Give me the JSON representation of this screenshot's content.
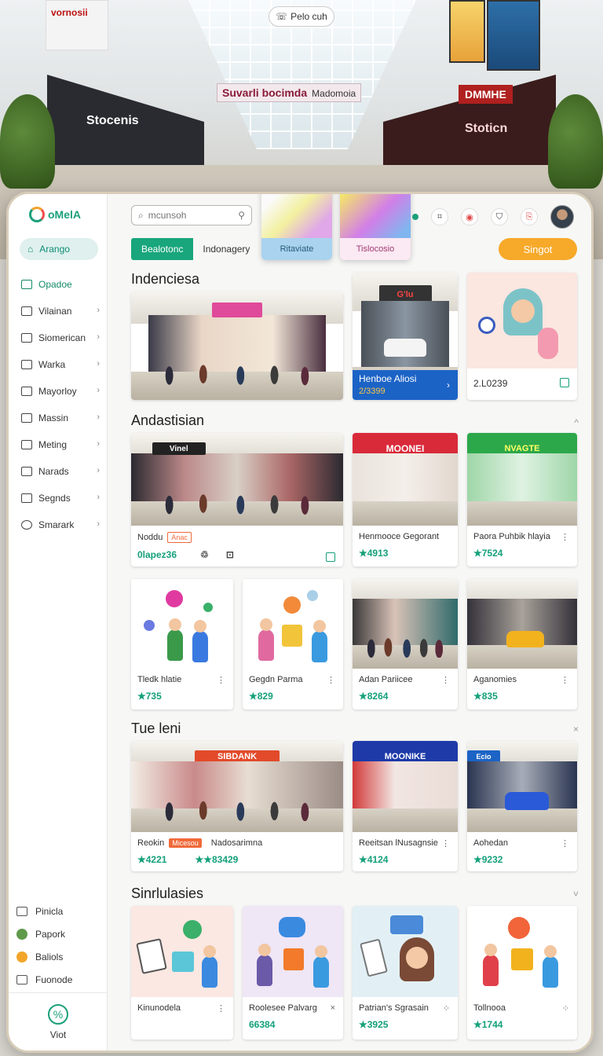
{
  "backdrop": {
    "banner_top": "vornosii",
    "banner_mid": "Suvarli bocimda",
    "banner_mid_sub": "Madomoia",
    "search_pill": "Pelo cuh",
    "store_sign_left": "Stocenis",
    "store_sign_right": "Stoticn",
    "store_sign_red": "DMMHE"
  },
  "app": {
    "logo": "oMelA",
    "search": {
      "placeholder": "mcunsoh"
    },
    "popups": [
      {
        "label": "Ritaviate"
      },
      {
        "label": "Tislocosio"
      }
    ],
    "tabs": [
      {
        "label": "Bealotonc"
      },
      {
        "label": "Indonagery"
      }
    ],
    "signup": "Singot",
    "colors": {
      "accent": "#19a67c",
      "cta": "#f7a92a",
      "value": "#14a07a",
      "caption": "#1c63c6",
      "tag": "#f06a3a"
    }
  },
  "sidebar": {
    "active": {
      "label": "Arango",
      "icon": "home-icon"
    },
    "items": [
      {
        "label": "Opadoe",
        "icon": "folder-icon",
        "green": true
      },
      {
        "label": "Vilainan",
        "icon": "list-icon"
      },
      {
        "label": "Siomerican",
        "icon": "tag-icon"
      },
      {
        "label": "Warka",
        "icon": "mail-icon"
      },
      {
        "label": "Mayorloy",
        "icon": "tag-icon"
      },
      {
        "label": "Massin",
        "icon": "list-icon"
      },
      {
        "label": "Meting",
        "icon": "tag-icon"
      },
      {
        "label": "Narads",
        "icon": "calendar-icon"
      },
      {
        "label": "Segnds",
        "icon": "box-icon"
      },
      {
        "label": "Smarark",
        "icon": "clock-icon"
      }
    ],
    "bottom": [
      {
        "label": "Pinicla",
        "icon": "calendar-icon"
      },
      {
        "label": "Papork",
        "icon": "green-dot-icon"
      },
      {
        "label": "Baliols",
        "icon": "orange-flower-icon"
      },
      {
        "label": "Fuonode",
        "icon": "calendar-icon"
      }
    ],
    "footer": "Viot"
  },
  "sections": [
    {
      "title": "Indenciesa",
      "cards": [
        {
          "caption": "",
          "value": ""
        },
        {
          "caption": "Henboe Aliosi",
          "value": "2/3399",
          "sign": "G'lu"
        },
        {
          "caption": "",
          "value": "2.L0239"
        }
      ]
    },
    {
      "title": "Andastisian",
      "cards": [
        {
          "name": "Noddu",
          "tag": "Anac",
          "value": "0lapez36",
          "sign": "Vinel"
        },
        {
          "name": "Henmooce Gegorant",
          "value": "★4913",
          "sign": "MOONEI"
        },
        {
          "name": "Paora Puhbik hlayia",
          "value": "★7524",
          "sign": "NVAGTE"
        }
      ],
      "cards_row2": [
        {
          "name": "Tledk hlatie",
          "value": "★735"
        },
        {
          "name": "Gegdn Parma",
          "value": "★829"
        },
        {
          "name": "Adan Pariicee",
          "value": "★8264"
        },
        {
          "name": "Aganomies",
          "value": "★835"
        }
      ]
    },
    {
      "title": "Tue leni",
      "cards": [
        {
          "name": "Reokin",
          "tag": "Micesou",
          "name2": "Nadosarimna",
          "value": "★4221",
          "value2": "★★83429",
          "sign": "SIBDANK"
        },
        {
          "name": "Reeitsan lNusagnsie",
          "value": "★4124",
          "sign": "MOONIKE"
        },
        {
          "name": "Aohedan",
          "value": "★9232",
          "sign": "Ecio"
        }
      ]
    },
    {
      "title": "Sinrlulasies",
      "cards": [
        {
          "name": "Kinunodela",
          "value": ""
        },
        {
          "name": "Roolesee Palvarg",
          "value": "66384"
        },
        {
          "name": "Patrian's Sgrasain",
          "value": "★3925"
        },
        {
          "name": "Tollnooa",
          "value": "★1744"
        }
      ]
    }
  ]
}
